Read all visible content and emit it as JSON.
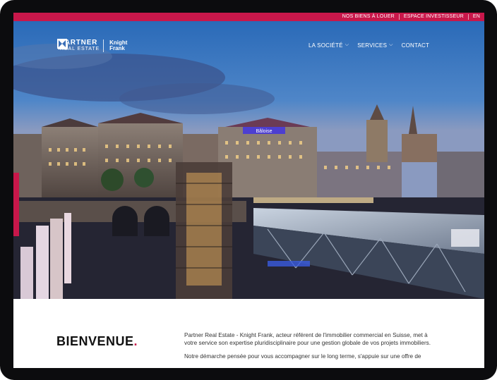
{
  "topbar": {
    "links": [
      "NOS BIENS À LOUER",
      "ESPACE INVESTISSEUR",
      "EN"
    ]
  },
  "logo": {
    "partner_line1": "PARTNER",
    "partner_line2": "REAL ESTATE",
    "kf_line1": "Knight",
    "kf_line2": "Frank"
  },
  "nav": {
    "items": [
      "LA SOCIÉTÉ",
      "SERVICES",
      "CONTACT"
    ]
  },
  "hero": {
    "signs": [
      "Bâloise"
    ]
  },
  "welcome": {
    "title": "BIENVENUE",
    "title_dot": "."
  },
  "intro": {
    "p1": "Partner Real Estate - Knight Frank, acteur référent de l'immobilier commercial en Suisse, met à votre service son expertise pluridisciplinaire pour une gestion globale de vos projets immobiliers.",
    "p2": "Notre démarche pensée pour vous accompagner sur le long terme, s'appuie sur une offre de"
  },
  "colors": {
    "accent": "#c8174a",
    "frame": "#0c0c0e"
  }
}
